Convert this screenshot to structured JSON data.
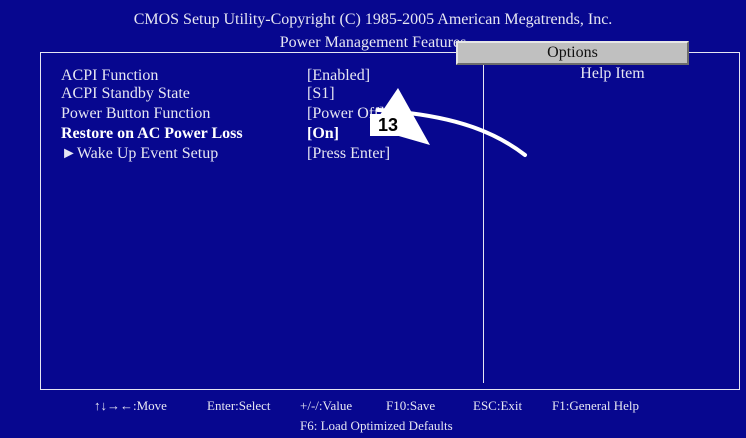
{
  "header": {
    "title": "CMOS Setup Utility-Copyright (C) 1985-2005 American Megatrends, Inc.",
    "subtitle": "Power Management Features"
  },
  "settings": [
    {
      "label": "ACPI Function",
      "value": "[Enabled]"
    },
    {
      "label": "ACPI Standby State",
      "value": "[S1]"
    },
    {
      "label": "Power Button Function",
      "value": "[Power Off]"
    },
    {
      "label": "Restore on AC Power Loss",
      "value": "[On]"
    },
    {
      "label": "Wake Up Event Setup",
      "value": "[Press Enter]"
    }
  ],
  "submenu_marker": "►",
  "help": {
    "header": "Help Item",
    "options_label": "Options"
  },
  "footer": {
    "move": "↑↓→←:Move",
    "select": "Enter:Select",
    "value": "+/-/:Value",
    "save": "F10:Save",
    "exit": "ESC:Exit",
    "general_help": "F1:General Help",
    "defaults": "F6: Load Optimized Defaults"
  },
  "callout": {
    "number": "13"
  },
  "colors": {
    "background": "#07078f",
    "text": "#e6e6f2",
    "options_box": "#c0c0c0"
  }
}
